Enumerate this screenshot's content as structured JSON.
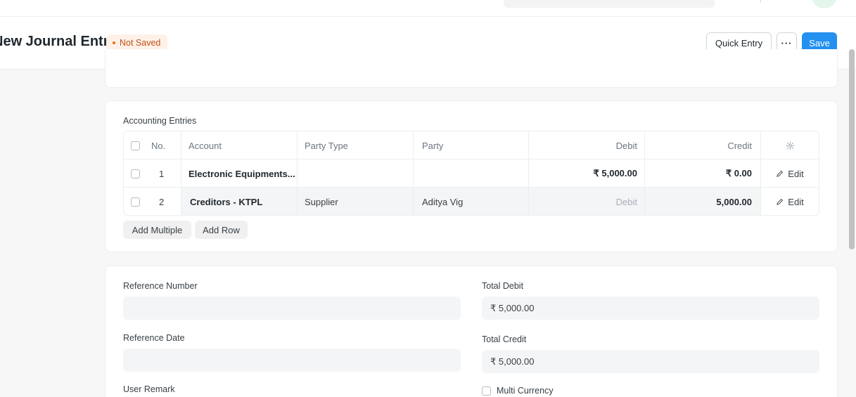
{
  "page": {
    "title": "New Journal Entry",
    "status": "Not Saved",
    "buttons": {
      "quick_entry": "Quick Entry",
      "more": "···",
      "save": "Save"
    }
  },
  "entries": {
    "label": "Accounting Entries",
    "columns": {
      "no": "No.",
      "account": "Account",
      "party_type": "Party Type",
      "party": "Party",
      "debit": "Debit",
      "credit": "Credit"
    },
    "rows": [
      {
        "no": "1",
        "account": "Electronic Equipments...",
        "party_type": "",
        "party": "",
        "debit": "₹ 5,000.00",
        "credit": "₹ 0.00",
        "edit": "Edit"
      },
      {
        "no": "2",
        "account": "Creditors - KTPL",
        "party_type": "Supplier",
        "party": "Aditya Vig",
        "debit": "Debit",
        "credit": "5,000.00",
        "edit": "Edit"
      }
    ],
    "add_multiple": "Add Multiple",
    "add_row": "Add Row"
  },
  "reference": {
    "reference_number_label": "Reference Number",
    "reference_number_value": "",
    "reference_date_label": "Reference Date",
    "reference_date_value": "",
    "user_remark_label": "User Remark",
    "total_debit_label": "Total Debit",
    "total_debit_value": "₹ 5,000.00",
    "total_credit_label": "Total Credit",
    "total_credit_value": "₹ 5,000.00",
    "multi_currency_label": "Multi Currency"
  },
  "colors": {
    "primary": "#2490ef",
    "status_bg": "#fff1e7",
    "status_text": "#c0521b"
  }
}
